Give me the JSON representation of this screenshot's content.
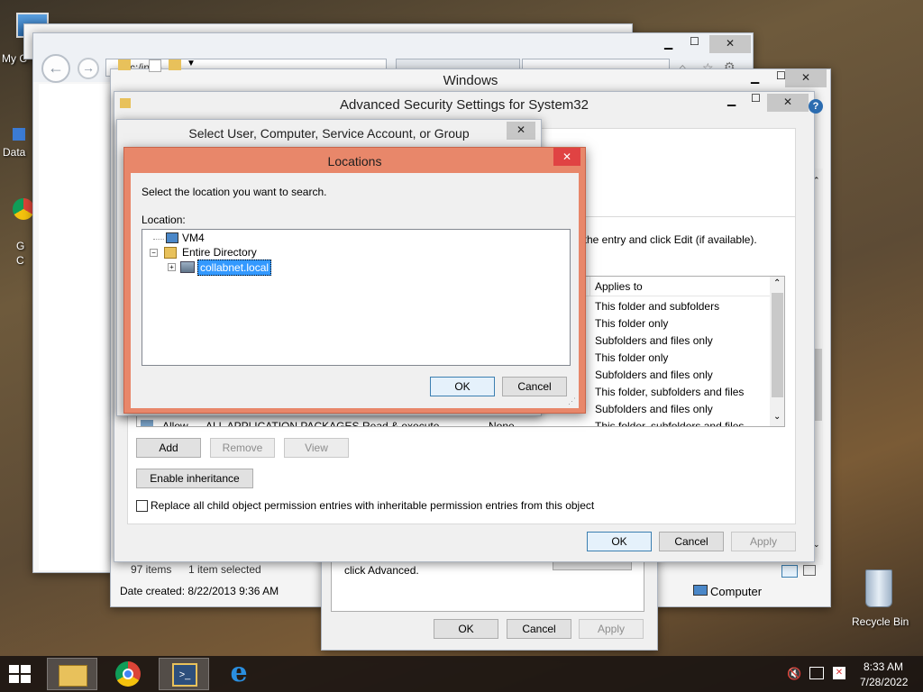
{
  "desktop": {
    "icons": [
      {
        "label": "My C"
      },
      {
        "label": "Data"
      },
      {
        "label": "G"
      },
      {
        "label": "C"
      },
      {
        "label": "Recycle Bin"
      }
    ]
  },
  "browser": {
    "address": "c:/infra..."
  },
  "explorer": {
    "title": "Windows",
    "status_items": "97 items",
    "status_selected": "1 item selected",
    "date_created": "Date created: 8/22/2013 9:36 AM",
    "computer_label": "Computer"
  },
  "advanced": {
    "title": "Advanced Security Settings for System32",
    "instructions": "ct the entry and click Edit (if available).",
    "applies_header": "Applies to",
    "applies": [
      "This folder and subfolders",
      "This folder only",
      "Subfolders and files only",
      "This folder only",
      "Subfolders and files only",
      "This folder, subfolders and files",
      "Subfolders and files only",
      "This folder, subfolders and files"
    ],
    "partial_row": {
      "type": "Allow",
      "principal": "ALL APPLICATION PACKAGES",
      "access": "Read & execute",
      "inherited": "None"
    },
    "add_label": "Add",
    "remove_label": "Remove",
    "view_label": "View",
    "enable_inheritance_label": "Enable inheritance",
    "replace_label": "Replace all child object permission entries with inheritable permission entries from this object",
    "ok_label": "OK",
    "cancel_label": "Cancel",
    "apply_label": "Apply"
  },
  "properties": {
    "advanced_hint": "click Advanced.",
    "ok_label": "OK",
    "cancel_label": "Cancel",
    "apply_label": "Apply"
  },
  "select_user": {
    "title": "Select User, Computer, Service Account, or Group"
  },
  "locations": {
    "title": "Locations",
    "prompt": "Select the location you want to search.",
    "location_label": "Location:",
    "tree": [
      {
        "label": "VM4"
      },
      {
        "label": "Entire Directory"
      },
      {
        "label": "collabnet.local"
      }
    ],
    "ok_label": "OK",
    "cancel_label": "Cancel"
  },
  "taskbar": {
    "time": "8:33 AM",
    "date": "7/28/2022"
  },
  "colors": {
    "locations_frame": "#e8876a",
    "selection": "#3399ff",
    "close_red": "#e04343"
  }
}
